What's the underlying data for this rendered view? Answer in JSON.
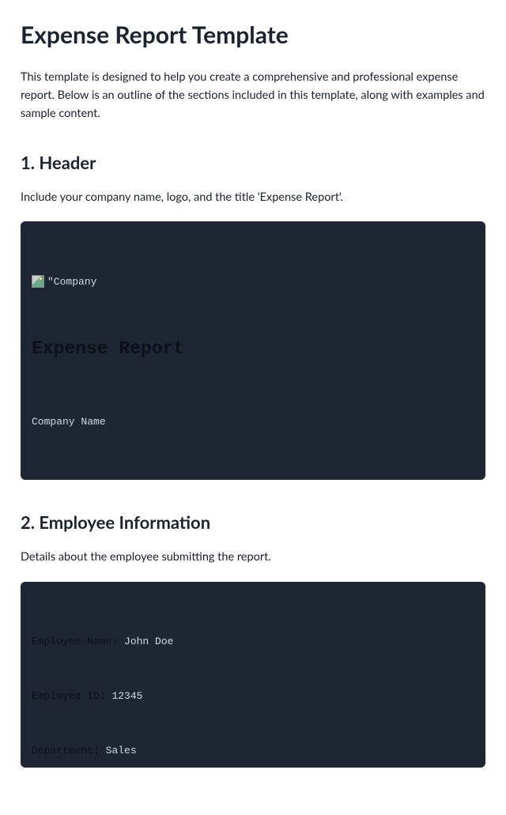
{
  "title": "Expense Report Template",
  "intro": "This template is designed to help you create a comprehensive and professional expense report. Below is an outline of the sections included in this template, along with examples and sample content.",
  "section1": {
    "heading": "1. Header",
    "desc": "Include your company name, logo, and the title 'Expense Report'.",
    "imgAlt": "\"Company",
    "codeTitle": "Expense Report",
    "companyName": "Company Name"
  },
  "section2": {
    "heading": "2. Employee Information",
    "desc": "Details about the employee submitting the report.",
    "fields": {
      "nameLabel": "Employee Name:",
      "nameValue": "John Doe",
      "idLabel": "Employee ID:",
      "idValue": "12345",
      "deptLabel": "Department:",
      "deptValue": "Sales"
    }
  }
}
